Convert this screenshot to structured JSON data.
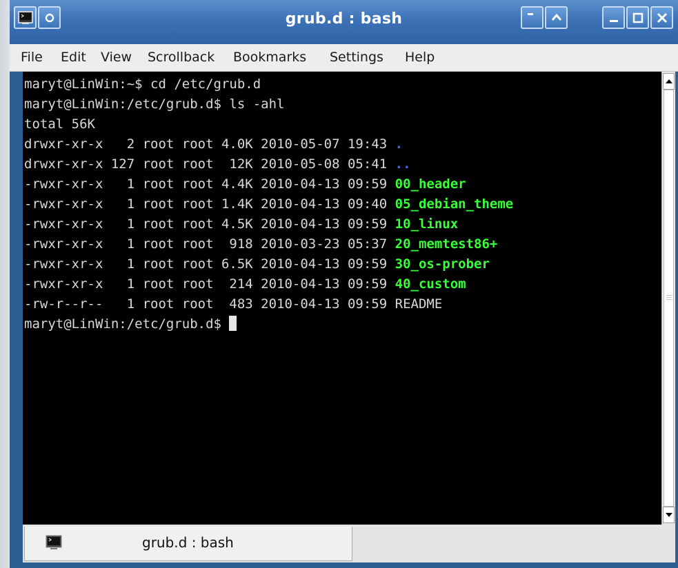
{
  "window": {
    "title": "grub.d : bash"
  },
  "icons": {
    "window_menu": "terminal-icon",
    "sticky": "circle-icon",
    "shade_up": "chevron-up-icon",
    "minimize": "minimize-icon",
    "maximize": "maximize-icon",
    "close": "close-icon"
  },
  "menubar": {
    "items": [
      "File",
      "Edit",
      "View",
      "Scrollback",
      "Bookmarks",
      "Settings",
      "Help"
    ]
  },
  "terminal": {
    "lines": [
      {
        "text": "maryt@LinWin:~$ cd /etc/grub.d"
      },
      {
        "text": "maryt@LinWin:/etc/grub.d$ ls -ahl"
      },
      {
        "text": "total 56K"
      },
      {
        "text": "drwxr-xr-x   2 root root 4.0K 2010-05-07 19:43 ",
        "name": ".",
        "type": "dir"
      },
      {
        "text": "drwxr-xr-x 127 root root  12K 2010-05-08 05:41 ",
        "name": "..",
        "type": "dir"
      },
      {
        "text": "-rwxr-xr-x   1 root root 4.4K 2010-04-13 09:59 ",
        "name": "00_header",
        "type": "exe"
      },
      {
        "text": "-rwxr-xr-x   1 root root 1.4K 2010-04-13 09:40 ",
        "name": "05_debian_theme",
        "type": "exe"
      },
      {
        "text": "-rwxr-xr-x   1 root root 4.5K 2010-04-13 09:59 ",
        "name": "10_linux",
        "type": "exe"
      },
      {
        "text": "-rwxr-xr-x   1 root root  918 2010-03-23 05:37 ",
        "name": "20_memtest86+",
        "type": "exe"
      },
      {
        "text": "-rwxr-xr-x   1 root root 6.5K 2010-04-13 09:59 ",
        "name": "30_os-prober",
        "type": "exe"
      },
      {
        "text": "-rwxr-xr-x   1 root root  214 2010-04-13 09:59 ",
        "name": "40_custom",
        "type": "exe"
      },
      {
        "text": "-rw-r--r--   1 root root  483 2010-04-13 09:59 ",
        "name": "README",
        "type": "file"
      },
      {
        "text": "maryt@LinWin:/etc/grub.d$ ",
        "cursor": true
      }
    ],
    "colors": {
      "background": "#000000",
      "text": "#d9d9d9",
      "directory": "#4b6bff",
      "executable": "#39ff3a"
    }
  },
  "tabs": [
    {
      "label": "grub.d : bash",
      "icon": "terminal-icon"
    }
  ],
  "theme": {
    "titlebar": "#3d72b6",
    "frame": "#2f5f92"
  }
}
